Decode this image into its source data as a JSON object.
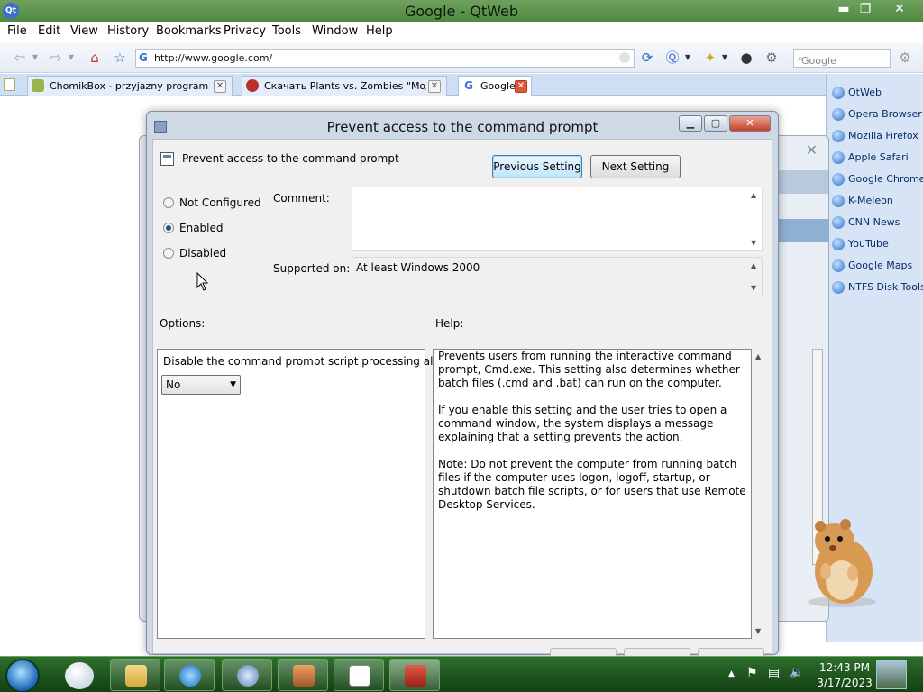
{
  "window": {
    "title": "Google - QtWeb",
    "app_icon": "qt"
  },
  "menubar": {
    "items": [
      "File",
      "Edit",
      "View",
      "History",
      "Bookmarks",
      "Privacy",
      "Tools",
      "Window",
      "Help"
    ]
  },
  "toolbar": {
    "url": "http://www.google.com/",
    "search_placeholder": "Google"
  },
  "tabs": [
    {
      "label": "ChomikBox - przyjazny program uł...",
      "favicon_color": "#9ab34a"
    },
    {
      "label": "Скачать Plants vs. Zombies \"Мод ...",
      "favicon_color": "#b7312a"
    },
    {
      "label": "Google",
      "favicon_color": "#ffffff"
    }
  ],
  "sidebar": {
    "items": [
      "QtWeb",
      "Opera Browser",
      "Mozilla Firefox",
      "Apple Safari",
      "Google Chrome",
      "K-Meleon",
      "CNN News",
      "YouTube",
      "Google Maps",
      "NTFS Disk Tools"
    ]
  },
  "dialog": {
    "title": "Prevent access to the command prompt",
    "policy_name": "Prevent access to the command prompt",
    "prev_button": "Previous Setting",
    "next_button": "Next Setting",
    "radio": {
      "not_configured": "Not Configured",
      "enabled": "Enabled",
      "disabled": "Disabled",
      "selected": "Enabled"
    },
    "comment_label": "Comment:",
    "comment_value": "",
    "supported_label": "Supported on:",
    "supported_value": "At least Windows 2000",
    "options_label": "Options:",
    "help_label": "Help:",
    "option_question": "Disable the command prompt script processing also?",
    "option_value": "No",
    "help_paragraphs": [
      "Prevents users from running the interactive command prompt, Cmd.exe. This setting also determines whether batch files (.cmd and .bat) can run on the computer.",
      "If you enable this setting and the user tries to open a command window, the system displays a message explaining that a setting prevents the action.",
      "Note: Do not prevent the computer from running batch files if the computer uses logon, logoff, startup, or shutdown batch file scripts, or for users that use Remote Desktop Services."
    ]
  },
  "taskbar": {
    "time": "12:43 PM",
    "date": "3/17/2023"
  },
  "colors": {
    "title_green": "#4f8a3f",
    "taskbar_green": "#124012",
    "sidebar_blue": "#d6e4f6"
  }
}
